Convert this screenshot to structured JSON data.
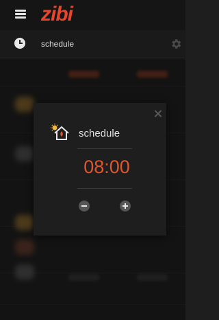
{
  "header": {
    "logo": "zibi"
  },
  "subheader": {
    "title": "schedule",
    "icons": {
      "left": "clock-icon",
      "right": "gear-icon"
    }
  },
  "dialog": {
    "title": "schedule",
    "icon": "house-icon",
    "time": "08:00",
    "decrement_icon": "minus-icon",
    "increment_icon": "plus-icon",
    "close_icon": "close-icon"
  },
  "colors": {
    "accent": "#e0562e",
    "logo": "#e8452c",
    "background": "#1e1e1e"
  }
}
